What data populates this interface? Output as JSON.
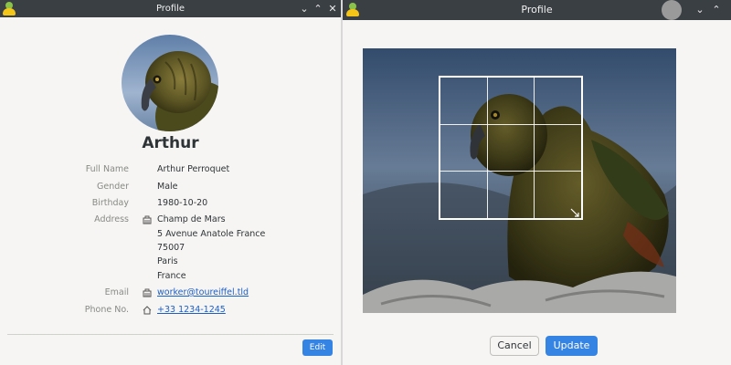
{
  "left_window": {
    "title": "Profile",
    "buttons": {
      "minimize": "⌄",
      "maximize": "⌃",
      "close": "✕"
    },
    "profile": {
      "name": "Arthur",
      "fields": {
        "full_name": {
          "label": "Full Name",
          "value": "Arthur Perroquet"
        },
        "gender": {
          "label": "Gender",
          "value": "Male"
        },
        "birthday": {
          "label": "Birthday",
          "value": "1980-10-20"
        },
        "address": {
          "label": "Address",
          "icon": "building-icon",
          "lines": [
            "Champ de Mars",
            "5 Avenue Anatole France",
            "75007",
            "Paris",
            "France"
          ]
        },
        "email": {
          "label": "Email",
          "icon": "building-icon",
          "value": "worker@toureiffel.tld"
        },
        "phone": {
          "label": "Phone No.",
          "icon": "home-icon",
          "value": "+33 1234-1245"
        }
      }
    },
    "edit_label": "Edit"
  },
  "right_window": {
    "title": "Profile",
    "buttons": {
      "minimize": "⌄",
      "maximize": "⌃"
    },
    "cancel_label": "Cancel",
    "update_label": "Update"
  },
  "colors": {
    "titlebar": "#3a3f44",
    "accent": "#3584e4",
    "link": "#1c5fc7",
    "window_bg": "#f6f5f4"
  }
}
